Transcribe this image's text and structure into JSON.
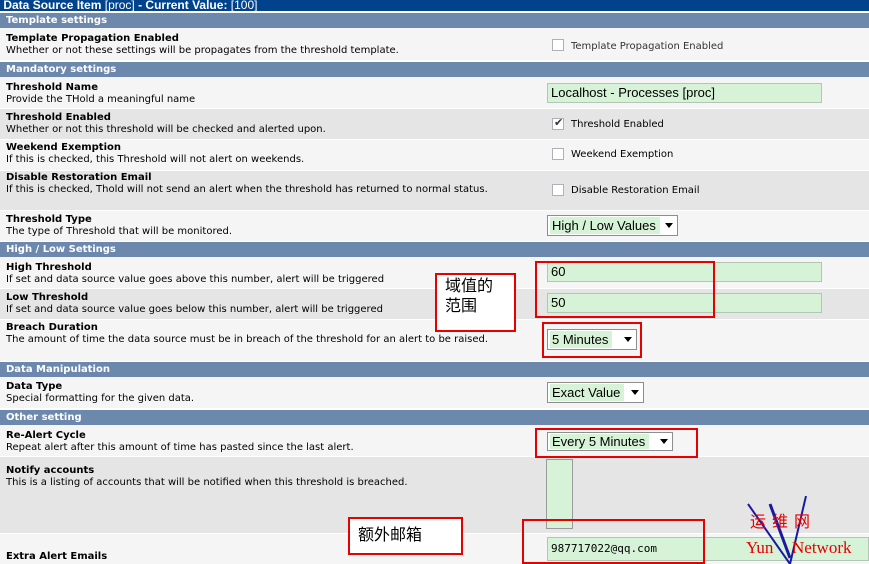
{
  "header": {
    "title": "Data Source Item",
    "ds": "[proc]",
    "current_label": " - Current Value:",
    "current_value": "[100]"
  },
  "sections": {
    "template": "Template settings",
    "mandatory": "Mandatory settings",
    "highlow": "High / Low Settings",
    "manipulation": "Data Manipulation",
    "other": "Other setting"
  },
  "rows": {
    "template_prop": {
      "title": "Template Propagation Enabled",
      "desc": "Whether or not these settings will be propagates from the threshold template.",
      "check_label": "Template Propagation Enabled",
      "checked": false
    },
    "threshold_name": {
      "title": "Threshold Name",
      "desc": "Provide the THold a meaningful name",
      "value": "Localhost - Processes [proc]"
    },
    "threshold_enabled": {
      "title": "Threshold Enabled",
      "desc": "Whether or not this threshold will be checked and alerted upon.",
      "check_label": "Threshold Enabled",
      "checked": true
    },
    "weekend": {
      "title": "Weekend Exemption",
      "desc": "If this is checked, this Threshold will not alert on weekends.",
      "check_label": "Weekend Exemption",
      "checked": false
    },
    "restoration": {
      "title": "Disable Restoration Email",
      "desc": "If this is checked, Thold will not send an alert when the threshold has returned to normal status.",
      "check_label": "Disable Restoration Email",
      "checked": false
    },
    "threshold_type": {
      "title": "Threshold Type",
      "desc": "The type of Threshold that will be monitored.",
      "value": "High / Low Values"
    },
    "high": {
      "title": "High Threshold",
      "desc": "If set and data source value goes above this number, alert will be triggered",
      "value": "60"
    },
    "low": {
      "title": "Low Threshold",
      "desc": "If set and data source value goes below this number, alert will be triggered",
      "value": "50"
    },
    "breach": {
      "title": "Breach Duration",
      "desc": "The amount of time the data source must be in breach of the threshold for an alert to be raised.",
      "value": "5 Minutes"
    },
    "data_type": {
      "title": "Data Type",
      "desc": "Special formatting for the given data.",
      "value": "Exact Value"
    },
    "realert": {
      "title": "Re-Alert Cycle",
      "desc": "Repeat alert after this amount of time has pasted since the last alert.",
      "value": "Every 5 Minutes"
    },
    "notify": {
      "title": "Notify accounts",
      "desc": "This is a listing of accounts that will be notified when this threshold is breached."
    },
    "extra_emails": {
      "title": "Extra Alert Emails",
      "value": "987717022@qq.com"
    }
  },
  "annotations": {
    "range": "域值的范围",
    "email": "额外邮箱"
  },
  "watermark": {
    "line1": "运维网",
    "yun": "Yun",
    "network": "Network",
    "colors": {
      "red": "#e60000",
      "blue": "#1a1aa0"
    }
  }
}
